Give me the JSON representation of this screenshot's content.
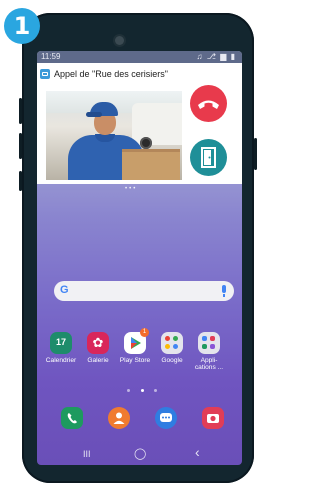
{
  "step": {
    "number": "1"
  },
  "status_bar": {
    "time": "11:59",
    "icons": "♫ ⎇ ▆ ▮"
  },
  "notification": {
    "title": "Appel de \"Rue des cerisiers\"",
    "accent": "#3c9ad9",
    "hangup_color": "#e83a4c",
    "door_color": "#1f8f98"
  },
  "pager_top": "•••",
  "search": {
    "g_label": "G"
  },
  "apps": [
    {
      "label": "Calendrier",
      "icon": "calendar-icon",
      "glyph": "17",
      "color": "#1e8c6b"
    },
    {
      "label": "Galerie",
      "icon": "gallery-icon",
      "glyph": "✿",
      "color": "#d9265a"
    },
    {
      "label": "Play Store",
      "icon": "play-store-icon",
      "glyph": "▶",
      "color": "#ffffff",
      "badge": "1"
    },
    {
      "label": "Google",
      "icon": "google-folder-icon",
      "glyph": "",
      "color": "#e4e4ec"
    },
    {
      "label": "Appli-\ncations ...",
      "icon": "apps-folder-icon",
      "glyph": "",
      "color": "#e4e4ec"
    }
  ],
  "dock": [
    {
      "icon": "phone-icon",
      "color": "#1e9a5f",
      "glyph": "☎"
    },
    {
      "icon": "contacts-icon",
      "color": "#f07b30",
      "glyph": "☺"
    },
    {
      "icon": "messages-icon",
      "color": "#2f7de1",
      "glyph": "…"
    },
    {
      "icon": "camera-icon",
      "color": "#e13d57",
      "glyph": "◉"
    }
  ],
  "navbar": {
    "recent": "III",
    "home": "◯",
    "back": "‹"
  }
}
